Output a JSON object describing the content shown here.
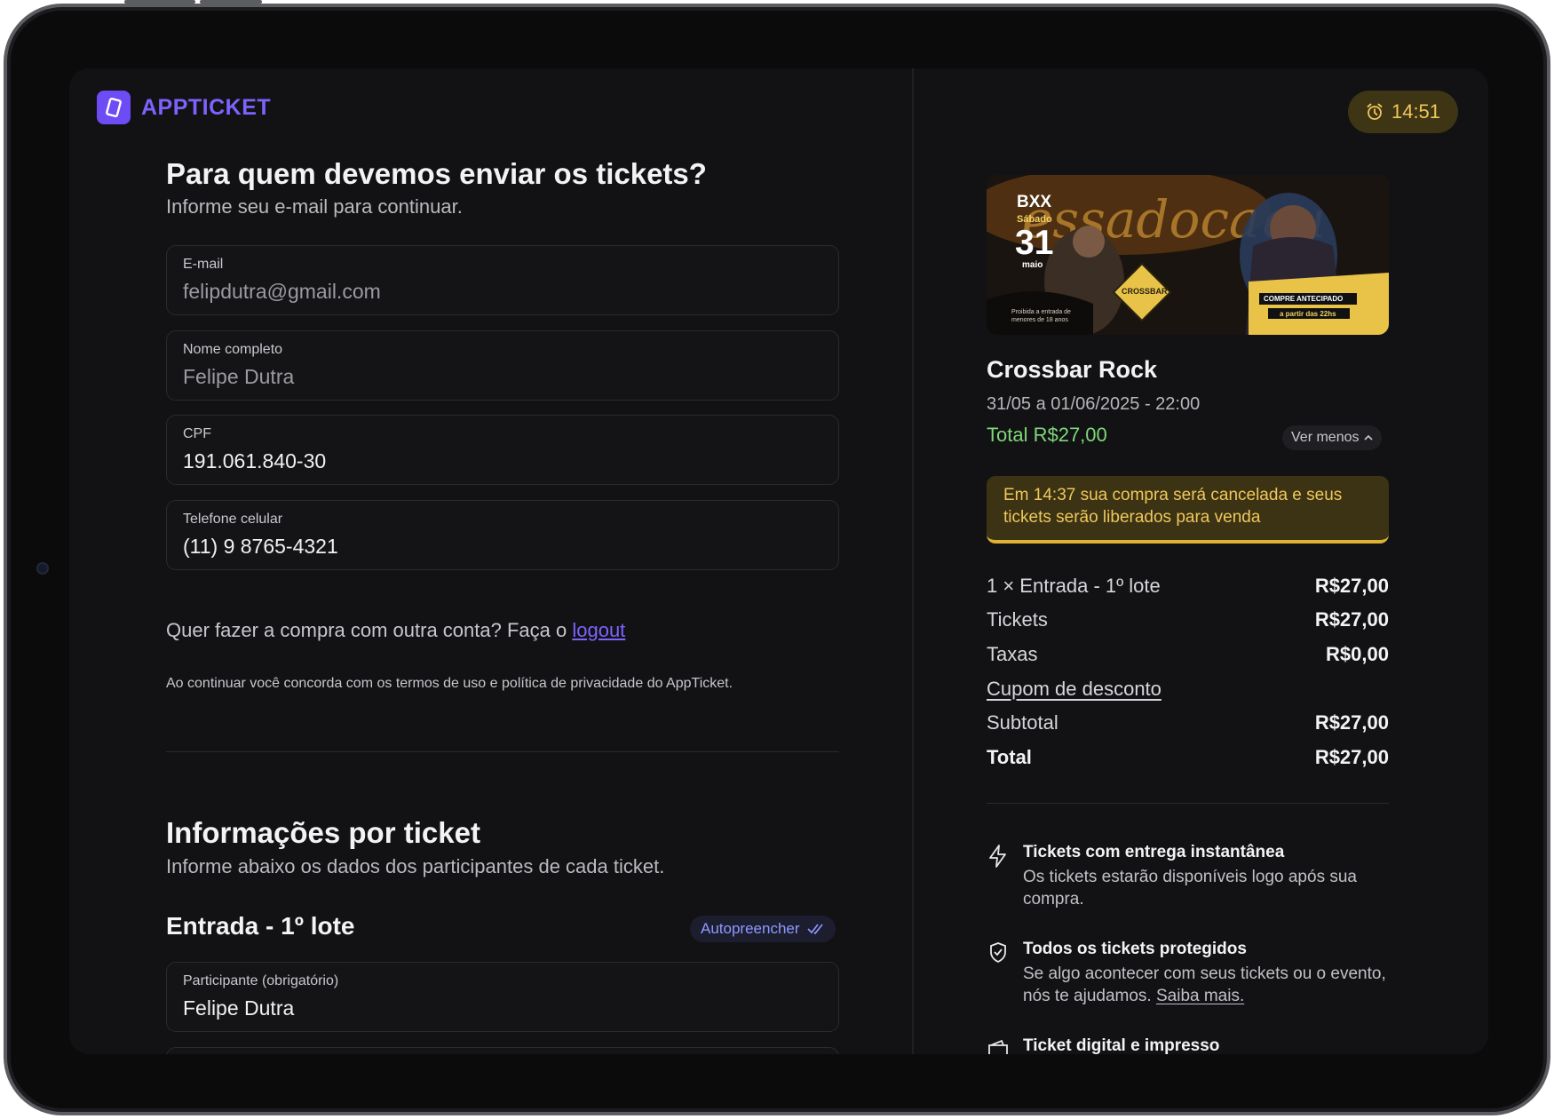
{
  "brand": {
    "name": "APPTICKET",
    "accent": "#6d4cf5"
  },
  "timer": {
    "value": "14:51",
    "icon": "alarm-clock-icon"
  },
  "contact": {
    "title": "Para quem devemos enviar os tickets?",
    "subtitle": "Informe seu e-mail para continuar.",
    "fields": [
      {
        "label": "E-mail",
        "value": "felipdutra@gmail.com"
      },
      {
        "label": "Nome completo",
        "value": "Felipe Dutra"
      },
      {
        "label": "CPF",
        "value": "191.061.840-30"
      },
      {
        "label": "Telefone celular",
        "value": "(11) 9 8765-4321"
      }
    ],
    "other_account_text": "Quer fazer a compra com outra conta? Faça o",
    "logout_link": "logout",
    "terms_prefix": "Ao continuar você concorda com os",
    "terms_link": "termos de uso",
    "terms_middle": "e",
    "privacy_link": "política de privacidade",
    "terms_suffix": "do AppTicket."
  },
  "tickets_info": {
    "title": "Informações por ticket",
    "subtitle": "Informe abaixo os dados dos participantes de cada ticket.",
    "ticket_name": "Entrada - 1º lote",
    "autofill_label": "Autopreencher",
    "participant_label": "Participante (obrigatório)",
    "participant_value": "Felipe Dutra"
  },
  "event": {
    "name": "Crossbar Rock",
    "dates": "31/05 a 01/06/2025 - 22:00",
    "total": "Total R$27,00",
    "toggle_label": "Ver menos",
    "banner": {
      "venue": "BXX",
      "day_label": "Sábado",
      "day": "31",
      "month": "maio",
      "logo": "CROSSBAR",
      "cta": "COMPRE ANTECIPADO",
      "time": "a partir das 22hs",
      "notice": "Proibida a entrada de menores de 18 anos"
    }
  },
  "warning": "Em 14:37 sua compra será cancelada e seus tickets serão liberados para venda",
  "summary": {
    "line_item": {
      "label": "1 × Entrada - 1º lote",
      "value": "R$27,00"
    },
    "tickets": {
      "label": "Tickets",
      "value": "R$27,00"
    },
    "fees": {
      "label": "Taxas",
      "value": "R$0,00"
    },
    "coupon": {
      "label": "Cupom de desconto"
    },
    "subtotal": {
      "label": "Subtotal",
      "value": "R$27,00"
    },
    "total": {
      "label": "Total",
      "value": "R$27,00"
    }
  },
  "features": [
    {
      "icon": "lightning-icon",
      "title": "Tickets com entrega instantânea",
      "desc": "Os tickets estarão disponíveis logo após sua compra."
    },
    {
      "icon": "shield-icon",
      "title": "Todos os tickets protegidos",
      "desc": "Se algo acontecer com seus tickets ou o evento, nós te ajudamos.",
      "link": "Saiba mais."
    },
    {
      "icon": "wallet-icon",
      "title": "Ticket digital e impresso"
    }
  ],
  "colors": {
    "background": "#121214",
    "warning": "#f0c75a",
    "total_green": "#7fd77a",
    "link": "#7d63ff"
  }
}
